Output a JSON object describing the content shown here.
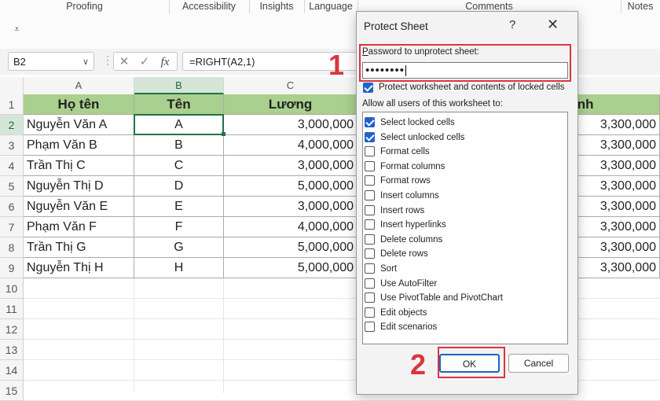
{
  "ribbon": {
    "groups": [
      "Proofing",
      "Accessibility",
      "Insights",
      "Language",
      "Comments",
      "Notes"
    ],
    "qat_icon": "customize-qat-icon"
  },
  "formula_bar": {
    "name_box": "B2",
    "formula": "=RIGHT(A2,1)",
    "cancel_symbol": "✕",
    "enter_symbol": "✓",
    "fx_symbol": "fx"
  },
  "grid": {
    "columns": [
      "A",
      "B",
      "C"
    ],
    "rows": [
      "1",
      "2",
      "3",
      "4",
      "5",
      "6",
      "7",
      "8",
      "9",
      "10",
      "11",
      "12",
      "13",
      "14",
      "15"
    ],
    "headers": [
      "Họ tên",
      "Tên",
      "Lương",
      "inh"
    ],
    "data": [
      [
        "Nguyễn Văn A",
        "A",
        "3,000,000",
        "3,300,000"
      ],
      [
        "Phạm Văn B",
        "B",
        "4,000,000",
        "3,300,000"
      ],
      [
        "Trần Thị C",
        "C",
        "3,000,000",
        "3,300,000"
      ],
      [
        "Nguyễn Thị D",
        "D",
        "5,000,000",
        "3,300,000"
      ],
      [
        "Nguyễn Văn E",
        "E",
        "3,000,000",
        "3,300,000"
      ],
      [
        "Phạm Văn F",
        "F",
        "4,000,000",
        "3,300,000"
      ],
      [
        "Trần Thị G",
        "G",
        "5,000,000",
        "3,300,000"
      ],
      [
        "Nguyễn Thị H",
        "H",
        "5,000,000",
        "3,300,000"
      ]
    ]
  },
  "dialog": {
    "title": "Protect Sheet",
    "help": "?",
    "close": "✕",
    "password_label": "Password to unprotect sheet:",
    "password_value": "••••••••",
    "protect_label": "Protect worksheet and contents of locked cells",
    "allow_label": "Allow all users of this worksheet to:",
    "permissions": [
      {
        "label": "Select locked cells",
        "checked": true
      },
      {
        "label": "Select unlocked cells",
        "checked": true
      },
      {
        "label": "Format cells",
        "checked": false
      },
      {
        "label": "Format columns",
        "checked": false
      },
      {
        "label": "Format rows",
        "checked": false
      },
      {
        "label": "Insert columns",
        "checked": false
      },
      {
        "label": "Insert rows",
        "checked": false
      },
      {
        "label": "Insert hyperlinks",
        "checked": false
      },
      {
        "label": "Delete columns",
        "checked": false
      },
      {
        "label": "Delete rows",
        "checked": false
      },
      {
        "label": "Sort",
        "checked": false
      },
      {
        "label": "Use AutoFilter",
        "checked": false
      },
      {
        "label": "Use PivotTable and PivotChart",
        "checked": false
      },
      {
        "label": "Edit objects",
        "checked": false
      },
      {
        "label": "Edit scenarios",
        "checked": false
      }
    ],
    "ok_label": "OK",
    "cancel_label": "Cancel"
  },
  "annotations": {
    "step1": "1",
    "step2": "2",
    "color": "#d9363e"
  },
  "colors": {
    "header_fill": "#a9d08e",
    "accent": "#217346",
    "checkbox": "#1f63c8"
  }
}
